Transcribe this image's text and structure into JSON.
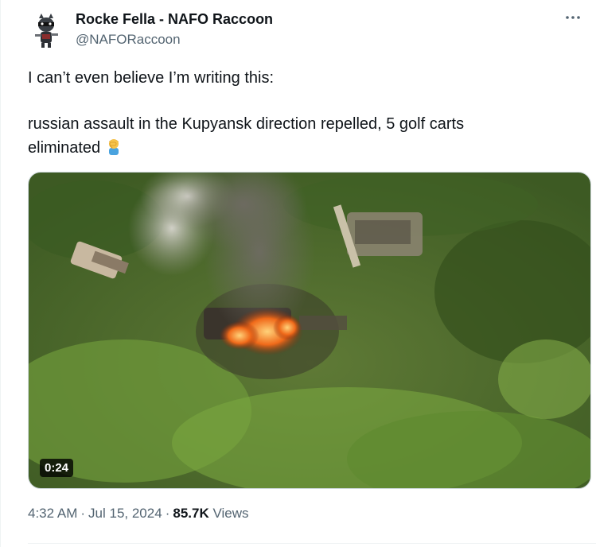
{
  "author": {
    "display_name": "Rocke Fella - NAFO Raccoon",
    "handle": "@NAFORaccoon"
  },
  "tweet": {
    "line1": "I can’t even believe I’m writing this:",
    "line2": "russian assault in the Kupyansk direction repelled, 5 golf carts",
    "line3": "eliminated",
    "emoji": "man-facepalming-emoji"
  },
  "media": {
    "type": "video",
    "duration": "0:24"
  },
  "meta": {
    "time": "4:32 AM",
    "separator": "·",
    "date": "Jul 15, 2024",
    "views_count": "85.7K",
    "views_label": "Views"
  },
  "icons": {
    "more": "more-options-icon"
  },
  "colors": {
    "text": "#0f1419",
    "secondary": "#536471",
    "border": "#cfd9de"
  }
}
